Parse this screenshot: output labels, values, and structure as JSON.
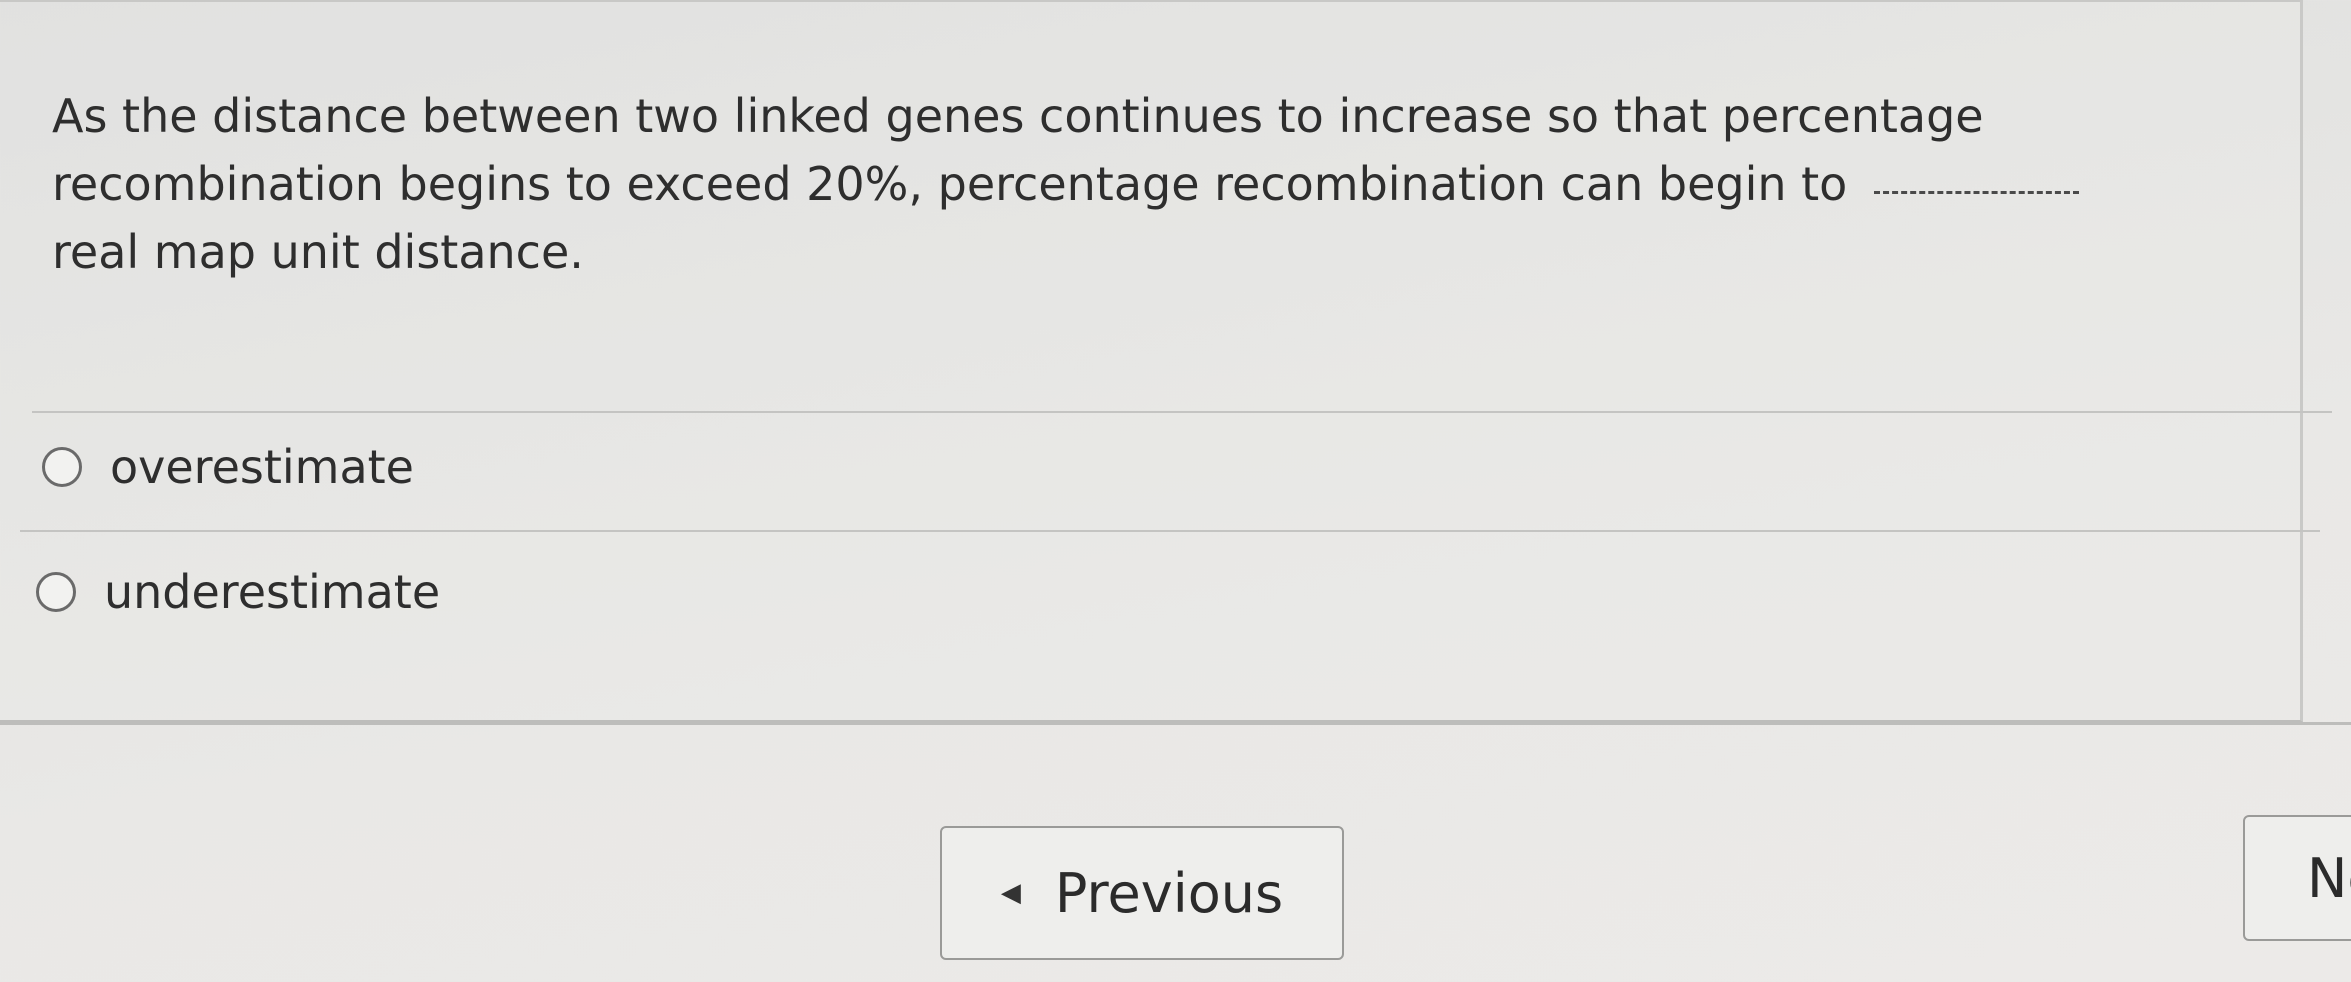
{
  "question": {
    "text_before_blank": "As the distance between two linked genes continues to increase so that percentage recombination begins to exceed 20%, percentage recombination can begin to",
    "text_after_blank": "real map unit distance."
  },
  "options": [
    {
      "label": "overestimate",
      "selected": false
    },
    {
      "label": "underestimate",
      "selected": false
    }
  ],
  "navigation": {
    "previous_label": "Previous",
    "next_label": "Ne"
  },
  "icons": {
    "previous": "caret-left-icon"
  }
}
